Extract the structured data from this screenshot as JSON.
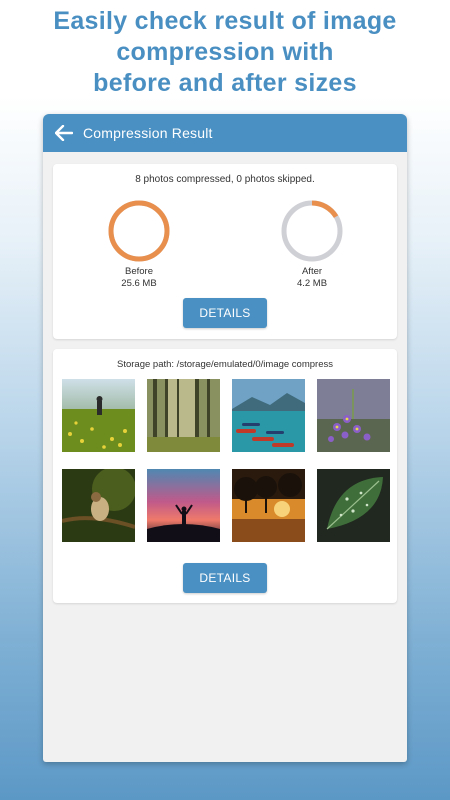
{
  "headline": {
    "line1": "Easily check result of image",
    "line2": "compression with",
    "line3": "before and after sizes"
  },
  "appbar": {
    "title": "Compression Result",
    "back_icon": "arrow-left-icon"
  },
  "result": {
    "summary": "8 photos compressed, 0 photos skipped.",
    "before": {
      "label": "Before",
      "size": "25.6 MB",
      "fraction": 1.0,
      "color": "#e98f4d"
    },
    "after": {
      "label": "After",
      "size": "4.2 MB",
      "fraction": 0.164,
      "color": "#e98f4d",
      "track_color": "#cfcfd6"
    },
    "details_label": "DETAILS"
  },
  "storage": {
    "path_text": "Storage path: /storage/emulated/0/image compress",
    "details_label": "DETAILS",
    "thumbnails": [
      "girl-in-meadow",
      "forest-sunbeams",
      "lake-boats",
      "purple-flowers",
      "bird-on-branch",
      "person-at-sunset",
      "trees-at-sunset",
      "leaf-with-raindrops"
    ]
  },
  "colors": {
    "accent": "#4a90c2",
    "ring": "#e98f4d"
  }
}
